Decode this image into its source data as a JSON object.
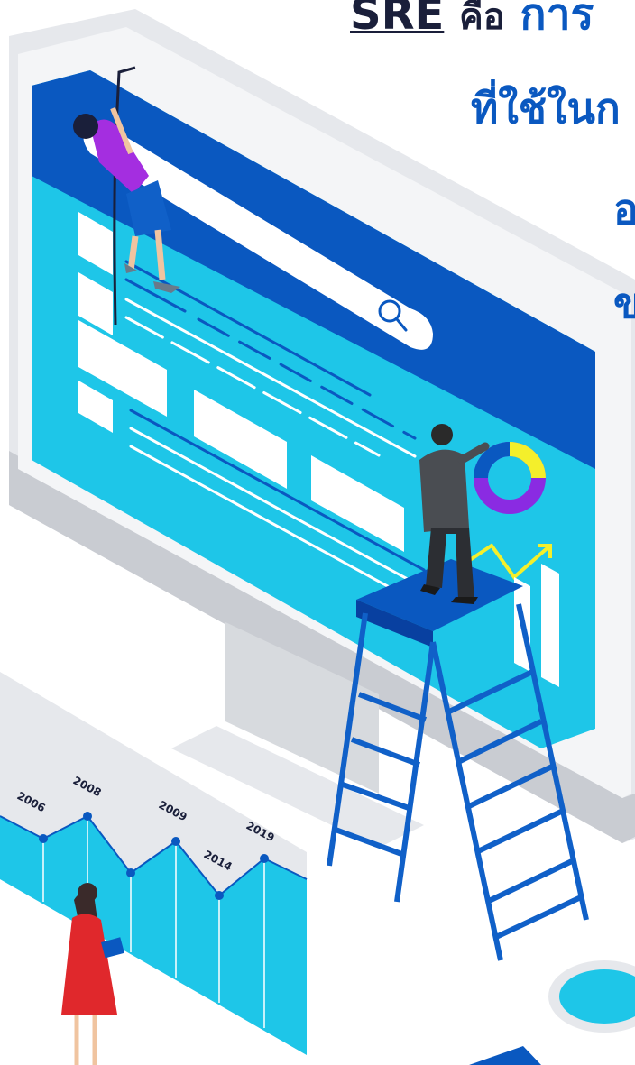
{
  "headline": {
    "term": "SRE",
    "connector": "คือ",
    "rest": "การ",
    "line2": "ที่ใช้ในก",
    "line3": "อ",
    "line4": "ข"
  },
  "timeline": {
    "years": [
      "2006",
      "2008",
      "2009",
      "2014",
      "2019"
    ]
  },
  "colors": {
    "brand_blue": "#0a58c0",
    "cyan": "#1ec6e8",
    "monitor_gray": "#e9eaed",
    "dark_text": "#1a1f3a"
  },
  "icons": [
    "search-icon",
    "donut-chart-icon",
    "trend-arrow-icon",
    "magnifier-icon"
  ]
}
